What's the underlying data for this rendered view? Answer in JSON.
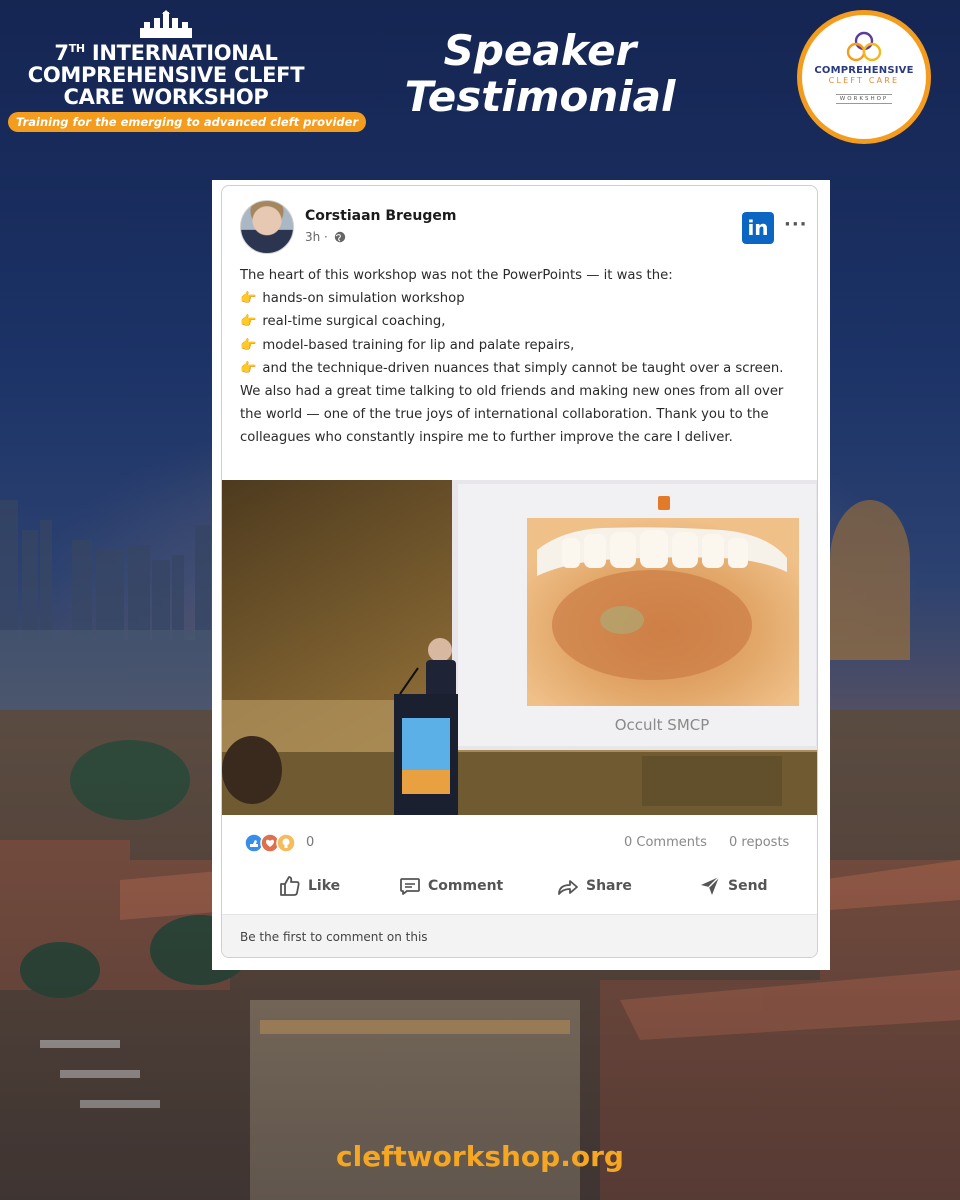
{
  "header": {
    "line1_num": "7",
    "line1_sup": "TH",
    "line1_rest": " INTERNATIONAL",
    "line2": "COMPREHENSIVE CLEFT",
    "line3": "CARE WORKSHOP",
    "tagline": "Training for the emerging to advanced cleft provider"
  },
  "title": {
    "line1": "Speaker",
    "line2": "Testimonial"
  },
  "logo": {
    "line1": "COMPREHENSIVE",
    "line2": "CLEFT CARE",
    "line3": "WORKSHOP"
  },
  "post": {
    "author": "Corstiaan Breugem",
    "time": "3h ·",
    "network_icon": "linkedin-icon",
    "intro": "The heart of this workshop was not the PowerPoints — it was the:",
    "bullets": [
      "hands-on simulation workshop",
      "real-time surgical coaching,",
      "model-based training for lip and palate repairs,",
      "and the technique-driven nuances that simply cannot be taught over a screen."
    ],
    "outro": "We also had a great time talking to old friends and making new ones from all over the world — one of the true joys of international collaboration. Thank you to the colleagues who constantly inspire me to further improve the care I deliver.",
    "slide_caption": "Occult SMCP",
    "reaction_count": "0",
    "comments": "0 Comments",
    "reposts": "0 reposts",
    "actions": {
      "like": "Like",
      "comment": "Comment",
      "share": "Share",
      "send": "Send"
    },
    "comment_prompt": "Be the first to comment on this"
  },
  "footer": {
    "url": "cleftworkshop.org"
  },
  "colors": {
    "accent_orange": "#f39c1e",
    "linkedin_blue": "#0a66c2",
    "navy": "#1c2f63"
  }
}
